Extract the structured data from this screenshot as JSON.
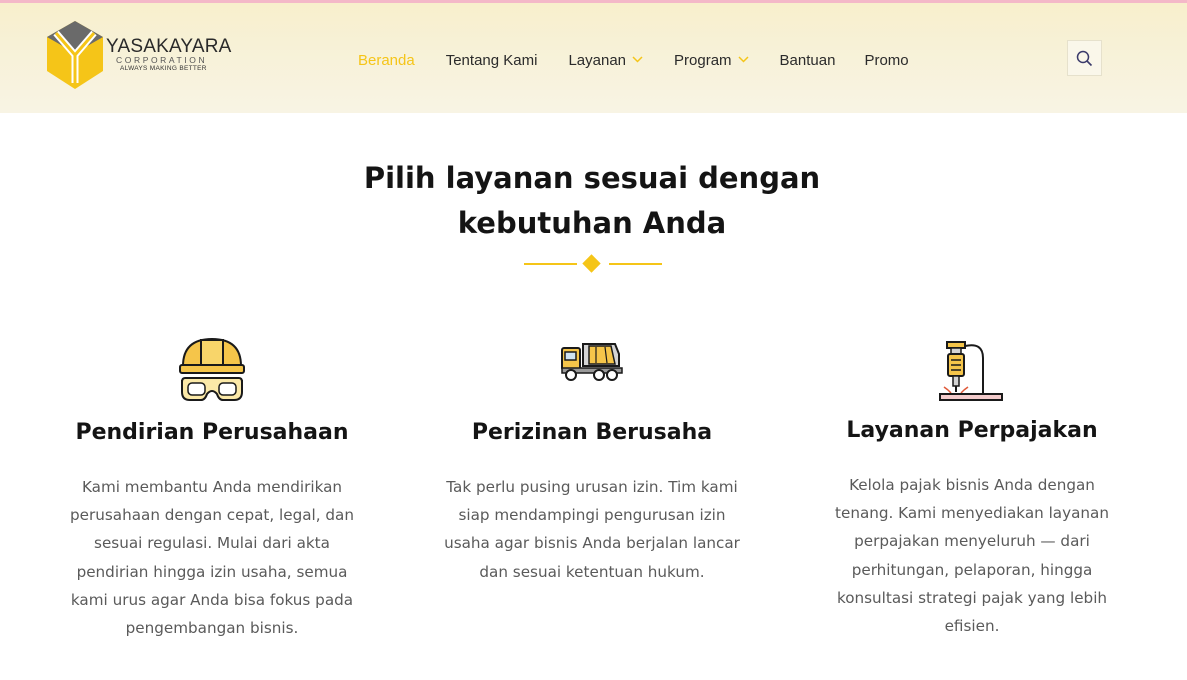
{
  "brand": {
    "name": "YASAKAYARA",
    "subtitle": "CORPORATION",
    "tagline": "ALWAYS MAKING BETTER",
    "accent_color": "#f5c518"
  },
  "nav": {
    "items": [
      {
        "label": "Beranda",
        "active": true,
        "has_dropdown": false
      },
      {
        "label": "Tentang Kami",
        "active": false,
        "has_dropdown": false
      },
      {
        "label": "Layanan",
        "active": false,
        "has_dropdown": true
      },
      {
        "label": "Program",
        "active": false,
        "has_dropdown": true
      },
      {
        "label": "Bantuan",
        "active": false,
        "has_dropdown": false
      },
      {
        "label": "Promo",
        "active": false,
        "has_dropdown": false
      }
    ],
    "search_icon": "search-icon",
    "dropdown_icon": "chevron-down-icon"
  },
  "section": {
    "title_line1": "Pilih layanan sesuai dengan",
    "title_line2": "kebutuhan Anda"
  },
  "services": [
    {
      "icon": "helmet-goggles-icon",
      "title": "Pendirian Perusahaan",
      "description": [
        "Kami membantu Anda mendirikan",
        "perusahaan dengan cepat, legal, dan",
        "sesuai regulasi. Mulai dari akta",
        "pendirian hingga izin usaha, semua",
        "kami urus agar Anda bisa fokus pada",
        "pengembangan bisnis."
      ]
    },
    {
      "icon": "mixer-truck-icon",
      "title": "Perizinan Berusaha",
      "description": [
        "Tak perlu pusing urusan izin. Tim kami",
        "siap mendampingi pengurusan izin",
        "usaha agar bisnis Anda berjalan lancar",
        "dan sesuai ketentuan hukum."
      ]
    },
    {
      "icon": "jackhammer-icon",
      "title": "Layanan Perpajakan",
      "description": [
        "Kelola pajak bisnis Anda dengan",
        "tenang. Kami menyediakan layanan",
        "perpajakan menyeluruh — dari",
        "perhitungan, pelaporan, hingga",
        "konsultasi strategi pajak yang lebih",
        "efisien."
      ]
    }
  ]
}
